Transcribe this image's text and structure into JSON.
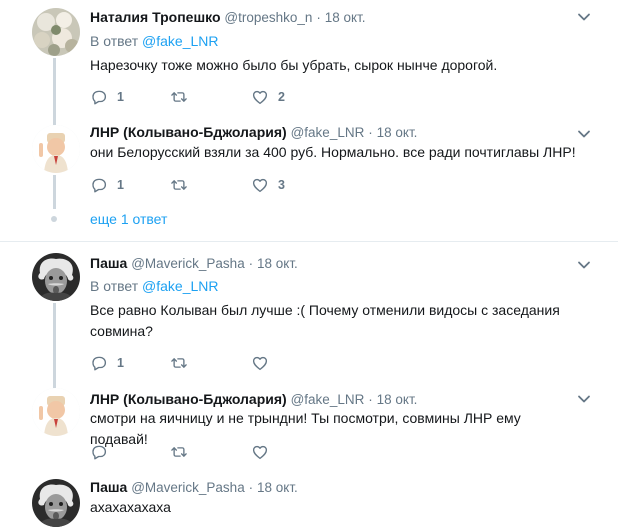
{
  "tweets": [
    {
      "name": "Наталия Тропешко",
      "handle": "@tropeshko_n",
      "dot": "·",
      "time": "18 окт.",
      "reply_prefix": "В ответ",
      "reply_to": "@fake_LNR",
      "text": "Нарезочку тоже можно было бы убрать, сырок нынче дорогой.",
      "replies": "1",
      "retweets": "",
      "likes": "2"
    },
    {
      "name": "ЛНР (Колывано-Бджолария)",
      "handle": "@fake_LNR",
      "dot": "·",
      "time": "18 окт.",
      "text": "они Белорусский взяли за 400 руб. Нормально. все ради почтиглавы ЛНР!",
      "replies": "1",
      "retweets": "",
      "likes": "3"
    },
    {
      "name": "Паша",
      "handle": "@Maverick_Pasha",
      "dot": "·",
      "time": "18 окт.",
      "reply_prefix": "В ответ",
      "reply_to": "@fake_LNR",
      "text": "Все равно Колыван был лучше :( Почему отменили видосы с заседания совмина?",
      "replies": "1",
      "retweets": "",
      "likes": ""
    },
    {
      "name": "ЛНР (Колывано-Бджолария)",
      "handle": "@fake_LNR",
      "dot": "·",
      "time": "18 окт.",
      "text": "смотри на яичницу и не трындни! Ты посмотри, совмины ЛНР ему подавай!",
      "replies": "",
      "retweets": "",
      "likes": ""
    },
    {
      "name": "Паша",
      "handle": "@Maverick_Pasha",
      "dot": "·",
      "time": "18 окт.",
      "text": "ахахахахаха"
    }
  ],
  "more_replies": "еще 1 ответ",
  "colors": {
    "link": "#1da1f2",
    "muted": "#657786",
    "separator": "#e6ecf0"
  },
  "icons": {
    "reply": "reply-icon",
    "retweet": "retweet-icon",
    "like": "heart-icon",
    "menu": "chevron-down-icon"
  }
}
